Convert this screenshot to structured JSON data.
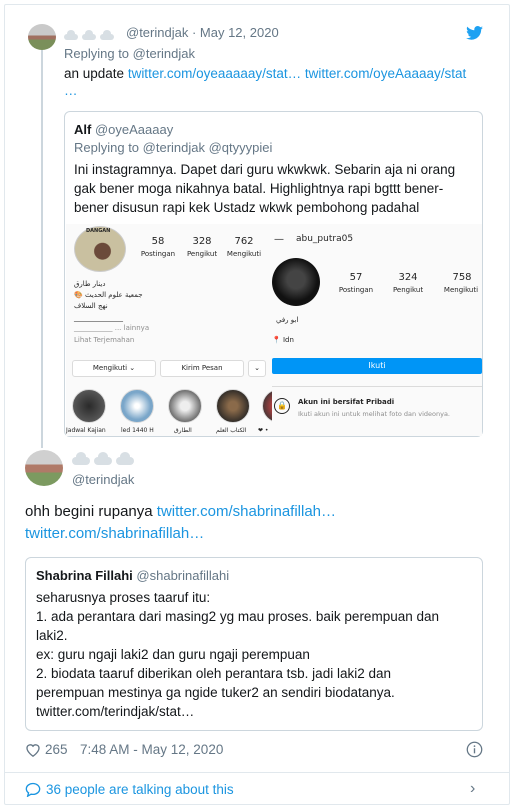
{
  "reply_tweet": {
    "handle": "@terindjak",
    "date": "May 12, 2020",
    "replying_prefix": "Replying to ",
    "replying_handle": "@terindjak",
    "text_prefix": "an update ",
    "link1": "twitter.com/oyeaaaaay/stat…",
    "link2": "twitter.com/oyeAaaaay/stat",
    "link_cont": "…"
  },
  "quote1": {
    "name": "Alf",
    "handle": "@oyeAaaaay",
    "replying_prefix": "Replying to ",
    "replying_handles": "@terindjak @qtyyypiei",
    "text": "Ini instagramnya. Dapet dari guru wkwkwk. Sebarin aja ni orang gak bener moga nikahnya batal. Highlightnya rapi bgttt bener-bener disusun rapi kek Ustadz wkwk pembohong padahal"
  },
  "ig_left": {
    "banner": "DANGAN",
    "posts": "58",
    "posts_label": "Postingan",
    "followers": "328",
    "followers_label": "Pengikut",
    "following": "762",
    "following_label": "Mengikuti",
    "bio1": "دينار طارق",
    "bio2": "🎨 جمعية علوم الحديث",
    "bio3": "نهج السلاف",
    "bio4": "______________",
    "bio5": "___________ ... lainnya",
    "see_translation": "Lihat Terjemahan",
    "btn_following": "Mengikuti ⌄",
    "btn_message": "Kirim Pesan",
    "btn_more": "⌄",
    "highlights": [
      "Jadwal Kajian",
      "led 1440 H",
      "الطارق",
      "الكتاب العلم",
      "❤ •"
    ]
  },
  "ig_right": {
    "username": "abu_putra05",
    "posts": "57",
    "posts_label": "Postingan",
    "followers": "324",
    "followers_label": "Pengikut",
    "following": "758",
    "following_label": "Mengikuti",
    "bio1": "ابو رفي",
    "bio2": "📍 Idn",
    "follow_btn": "Ikuti",
    "private_title": "Akun ini bersifat Pribadi",
    "private_sub": "Ikuti akun ini untuk melihat foto dan videonya."
  },
  "main_tweet": {
    "handle": "@terindjak",
    "text_prefix": "ohh begini rupanya ",
    "link1": "twitter.com/shabrinafillah…",
    "link2": "twitter.com/shabrinafillah…"
  },
  "quote2": {
    "name": "Shabrina Fillahi",
    "handle": "@shabrinafillahi",
    "line1": "seharusnya proses taaruf itu:",
    "line2": "1. ada perantara dari masing2 yg mau proses. baik perempuan dan",
    "line3": "laki2.",
    "line4": "ex: guru ngaji laki2 dan guru ngaji perempuan",
    "line5": "2. biodata taaruf diberikan oleh perantara tsb. jadi laki2 dan",
    "line6": "perempuan mestinya ga  ngide tuker2 an sendiri biodatanya.",
    "line7": "twitter.com/terindjak/stat…"
  },
  "footer": {
    "likes": "265",
    "timestamp": "7:48 AM - May 12, 2020",
    "talking": "36 people are talking about this"
  },
  "colors": {
    "link": "#1b95e0",
    "muted": "#657786",
    "twitter_blue": "#1da1f2",
    "ig_blue": "#0095f6"
  }
}
